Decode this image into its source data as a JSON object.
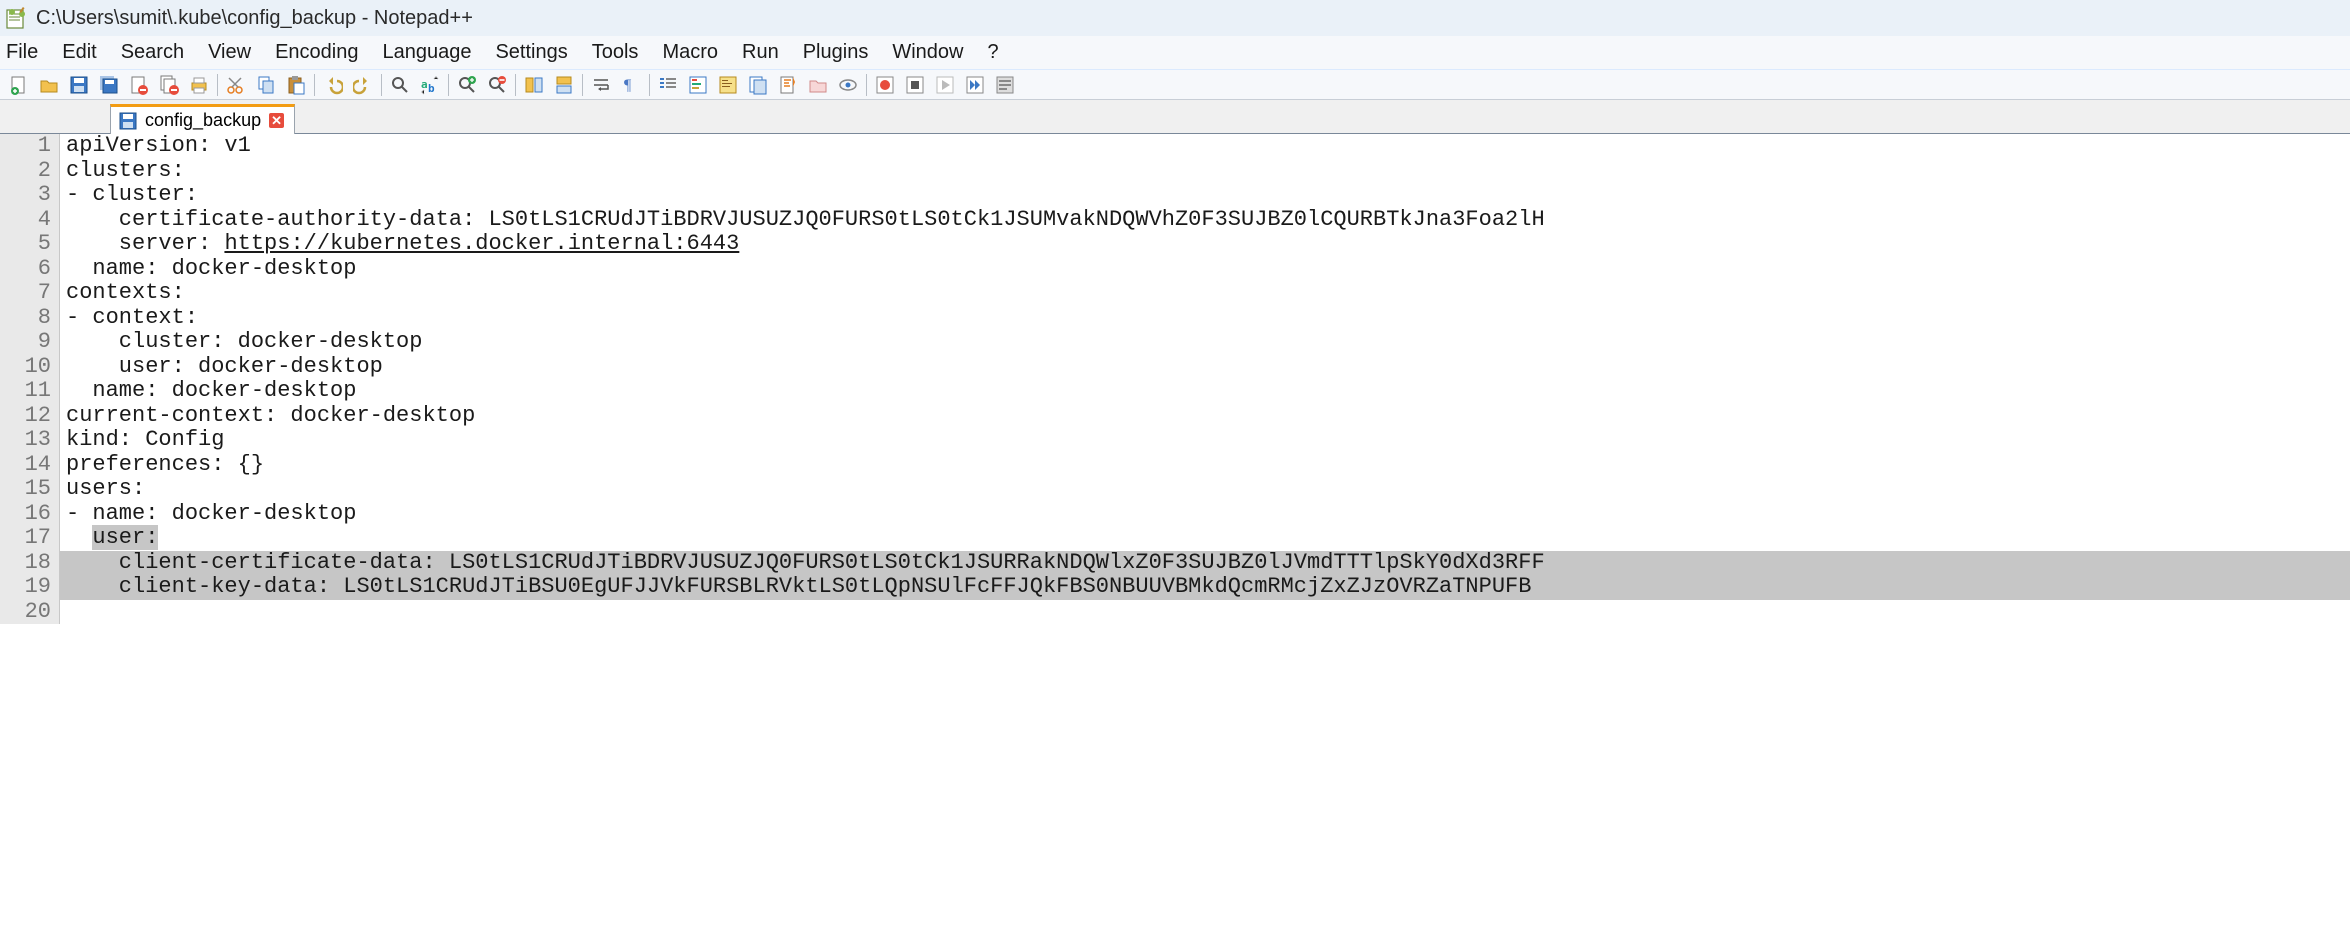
{
  "window": {
    "title": "C:\\Users\\sumit\\.kube\\config_backup - Notepad++"
  },
  "menu": {
    "items": [
      "File",
      "Edit",
      "Search",
      "View",
      "Encoding",
      "Language",
      "Settings",
      "Tools",
      "Macro",
      "Run",
      "Plugins",
      "Window",
      "?"
    ]
  },
  "toolbar": {
    "icons": [
      "new-file",
      "open-file",
      "save",
      "save-all",
      "close-file",
      "close-all",
      "print",
      "cut",
      "copy",
      "paste",
      "undo",
      "redo",
      "find",
      "replace",
      "zoom-in",
      "zoom-out",
      "sync-v",
      "sync-h",
      "wrap",
      "show-all",
      "indent-guide",
      "udl",
      "doc-map",
      "func-list",
      "folder",
      "monitor",
      "record",
      "stop",
      "play",
      "fast",
      "macro-list"
    ]
  },
  "tab": {
    "label": "config_backup"
  },
  "editor": {
    "lines": [
      {
        "n": 1,
        "text": "apiVersion: v1",
        "sel": false
      },
      {
        "n": 2,
        "text": "clusters:",
        "sel": false
      },
      {
        "n": 3,
        "text": "- cluster:",
        "sel": false
      },
      {
        "n": 4,
        "text": "    certificate-authority-data: LS0tLS1CRUdJTiBDRVJUSUZJQ0FURS0tLS0tCk1JSUMvakNDQWVhZ0F3SUJBZ0lCQURBTkJna3Foa2lH",
        "sel": false
      },
      {
        "n": 5,
        "text": "    server: ",
        "url": "https://kubernetes.docker.internal:6443",
        "sel": false
      },
      {
        "n": 6,
        "text": "  name: docker-desktop",
        "sel": false
      },
      {
        "n": 7,
        "text": "contexts:",
        "sel": false
      },
      {
        "n": 8,
        "text": "- context:",
        "sel": false
      },
      {
        "n": 9,
        "text": "    cluster: docker-desktop",
        "sel": false
      },
      {
        "n": 10,
        "text": "    user: docker-desktop",
        "sel": false
      },
      {
        "n": 11,
        "text": "  name: docker-desktop",
        "sel": false
      },
      {
        "n": 12,
        "text": "current-context: docker-desktop",
        "sel": false
      },
      {
        "n": 13,
        "text": "kind: Config",
        "sel": false
      },
      {
        "n": 14,
        "text": "preferences: {}",
        "sel": false
      },
      {
        "n": 15,
        "text": "users:",
        "sel": false
      },
      {
        "n": 16,
        "text": "- name: docker-desktop",
        "sel": false
      },
      {
        "n": 17,
        "prefix": "  ",
        "seltext": "user:",
        "sel": "partial"
      },
      {
        "n": 18,
        "text": "    client-certificate-data: LS0tLS1CRUdJTiBDRVJUSUZJQ0FURS0tLS0tCk1JSURRakNDQWlxZ0F3SUJBZ0lJVmdTTTlpSkY0dXd3RFF",
        "sel": true
      },
      {
        "n": 19,
        "text": "    client-key-data: LS0tLS1CRUdJTiBSU0EgUFJJVkFURSBLRVktLS0tLQpNSUlFcFFJQkFBS0NBUUVBMkdQcmRMcjZxZJzOVRZaTNPUFB",
        "sel": true
      },
      {
        "n": 20,
        "text": "",
        "sel": false
      }
    ]
  }
}
